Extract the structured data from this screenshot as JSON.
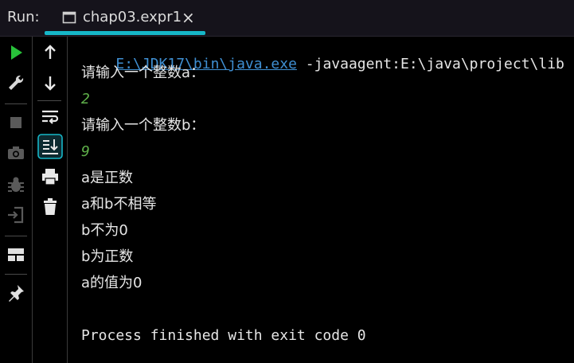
{
  "header": {
    "run_label": "Run:",
    "tab_title": "chap03.expr1",
    "tab_close": "×",
    "accent": "#16b7c8"
  },
  "left_toolbar": {
    "buttons": [
      "rerun-icon",
      "wrench-icon",
      "stop-icon",
      "camera-icon",
      "debug-bug-icon",
      "login-icon",
      "layout-icon",
      "pin-icon"
    ]
  },
  "second_toolbar": {
    "buttons": [
      "arrow-up-icon",
      "arrow-down-icon",
      "soft-wrap-icon",
      "scroll-to-end-icon",
      "print-icon",
      "trash-icon"
    ]
  },
  "console": {
    "cmd_path": "E:\\JDK17\\bin\\java.exe",
    "cmd_args": " -javaagent:E:\\java\\project\\lib",
    "lines": [
      "请输入一个整数a：",
      "2",
      "请输入一个整数b：",
      "9",
      "a是正数",
      "a和b不相等",
      "b不为0",
      "b为正数",
      "a的值为0",
      "Process finished with exit code 0"
    ],
    "colors": {
      "path": "#3f8fd2",
      "input": "#5fb04a",
      "text": "#e6e6e6",
      "background": "#000000"
    }
  }
}
